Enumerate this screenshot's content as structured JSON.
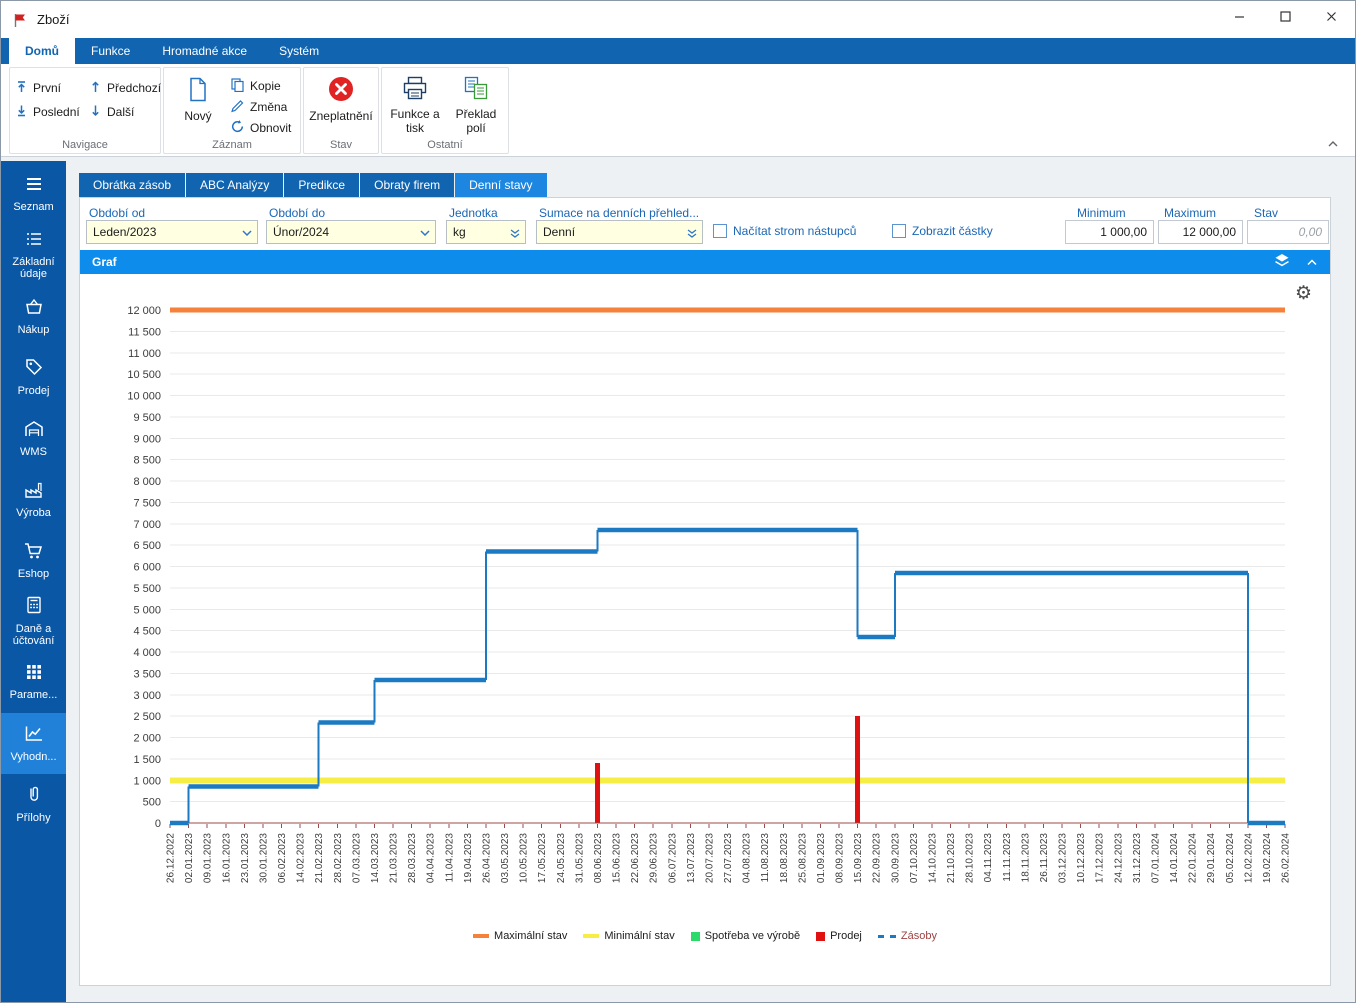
{
  "window": {
    "title": "Zboží"
  },
  "icons": {
    "gear": "⚙"
  },
  "ribbon": {
    "tabs": [
      {
        "label": "Domů",
        "active": true
      },
      {
        "label": "Funkce",
        "active": false
      },
      {
        "label": "Hromadné akce",
        "active": false
      },
      {
        "label": "Systém",
        "active": false
      }
    ],
    "navigace": {
      "label": "Navigace",
      "prvni": "První",
      "posledni": "Poslední",
      "predchozi": "Předchozí",
      "dalsi": "Další"
    },
    "zaznam": {
      "label": "Záznam",
      "novy": "Nový",
      "kopie": "Kopie",
      "zmena": "Změna",
      "obnovit": "Obnovit"
    },
    "stav": {
      "label": "Stav",
      "zneplatneni": "Zneplatnění"
    },
    "ostatni": {
      "label": "Ostatní",
      "funkce_a_tisk": "Funkce a tisk",
      "preklad_poli": "Překlad polí"
    }
  },
  "sidebar": {
    "items": [
      {
        "label": "Seznam",
        "active": false
      },
      {
        "label": "Základní údaje",
        "active": false
      },
      {
        "label": "Nákup",
        "active": false
      },
      {
        "label": "Prodej",
        "active": false
      },
      {
        "label": "WMS",
        "active": false
      },
      {
        "label": "Výroba",
        "active": false
      },
      {
        "label": "Eshop",
        "active": false
      },
      {
        "label": "Daně a účtování",
        "active": false
      },
      {
        "label": "Parame...",
        "active": false
      },
      {
        "label": "Vyhodn...",
        "active": true
      },
      {
        "label": "Přílohy",
        "active": false
      }
    ]
  },
  "content": {
    "tabs": [
      {
        "label": "Obrátka zásob",
        "active": false
      },
      {
        "label": "ABC Analýzy",
        "active": false
      },
      {
        "label": "Predikce",
        "active": false
      },
      {
        "label": "Obraty firem",
        "active": false
      },
      {
        "label": "Denní stavy",
        "active": true
      }
    ],
    "filters": {
      "obdobi_od": {
        "label": "Období od",
        "value": "Leden/2023"
      },
      "obdobi_do": {
        "label": "Období do",
        "value": "Únor/2024"
      },
      "jednotka": {
        "label": "Jednotka",
        "value": "kg"
      },
      "sumace": {
        "label": "Sumace na denních přehled...",
        "value": "Denní"
      },
      "nacitat_strom": {
        "label": "Načítat strom nástupců",
        "checked": false
      },
      "zobrazit_castky": {
        "label": "Zobrazit částky",
        "checked": false
      },
      "minimum": {
        "label": "Minimum",
        "value": "1 000,00"
      },
      "maximum": {
        "label": "Maximum",
        "value": "12 000,00"
      },
      "stav": {
        "label": "Stav",
        "value": "0,00"
      }
    },
    "graf": {
      "title": "Graf"
    }
  },
  "chart_data": {
    "type": "line",
    "title": "Graf",
    "y_axis": {
      "min": 0,
      "max": 12000,
      "step": 500
    },
    "axis_color": "#9b4b4b",
    "grid_color": "#e9e9e9",
    "legend_position": "bottom",
    "x_labels_rotated": true,
    "categories": [
      "26.12.2022",
      "02.01.2023",
      "09.01.2023",
      "16.01.2023",
      "23.01.2023",
      "30.01.2023",
      "06.02.2023",
      "14.02.2023",
      "21.02.2023",
      "28.02.2023",
      "07.03.2023",
      "14.03.2023",
      "21.03.2023",
      "28.03.2023",
      "04.04.2023",
      "11.04.2023",
      "19.04.2023",
      "26.04.2023",
      "03.05.2023",
      "10.05.2023",
      "17.05.2023",
      "24.05.2023",
      "31.05.2023",
      "08.06.2023",
      "15.06.2023",
      "22.06.2023",
      "29.06.2023",
      "06.07.2023",
      "13.07.2023",
      "20.07.2023",
      "27.07.2023",
      "04.08.2023",
      "11.08.2023",
      "18.08.2023",
      "25.08.2023",
      "01.09.2023",
      "08.09.2023",
      "15.09.2023",
      "22.09.2023",
      "30.09.2023",
      "07.10.2023",
      "14.10.2023",
      "21.10.2023",
      "28.10.2023",
      "04.11.2023",
      "11.11.2023",
      "18.11.2023",
      "26.11.2023",
      "03.12.2023",
      "10.12.2023",
      "17.12.2023",
      "24.12.2023",
      "31.12.2023",
      "07.01.2024",
      "14.01.2024",
      "22.01.2024",
      "29.01.2024",
      "05.02.2024",
      "12.02.2024",
      "19.02.2024",
      "26.02.2024"
    ],
    "series": [
      {
        "name": "Maximální stav",
        "type": "hline",
        "marker": "dash",
        "color": "#f5813a",
        "thickness": 5,
        "value": 12000
      },
      {
        "name": "Minimální stav",
        "type": "hline",
        "marker": "dash",
        "color": "#f6ee44",
        "thickness": 6,
        "value": 1000
      },
      {
        "name": "Spotřeba ve výrobě",
        "type": "bar",
        "marker": "square",
        "color": "#2cd96b",
        "thickness": 5,
        "points": []
      },
      {
        "name": "Prodej",
        "type": "bar",
        "marker": "square",
        "color": "#e01111",
        "thickness": 5,
        "points": [
          {
            "category": "08.06.2023",
            "value": 1400
          },
          {
            "category": "15.09.2023",
            "value": 2500
          }
        ]
      },
      {
        "name": "Zásoby",
        "type": "step-line",
        "marker": "dashes",
        "color": "#1b7ac2",
        "label_color": "#9c4343",
        "thickness": 4.5,
        "points": [
          {
            "category": "26.12.2022",
            "value": 0
          },
          {
            "category": "02.01.2023",
            "value": 850
          },
          {
            "category": "21.02.2023",
            "value": 2350
          },
          {
            "category": "14.03.2023",
            "value": 3350
          },
          {
            "category": "26.04.2023",
            "value": 6350
          },
          {
            "category": "08.06.2023",
            "value": 6850
          },
          {
            "category": "15.09.2023",
            "value": 4350
          },
          {
            "category": "30.09.2023",
            "value": 5850
          },
          {
            "category": "12.02.2024",
            "value": 0
          }
        ]
      }
    ]
  }
}
